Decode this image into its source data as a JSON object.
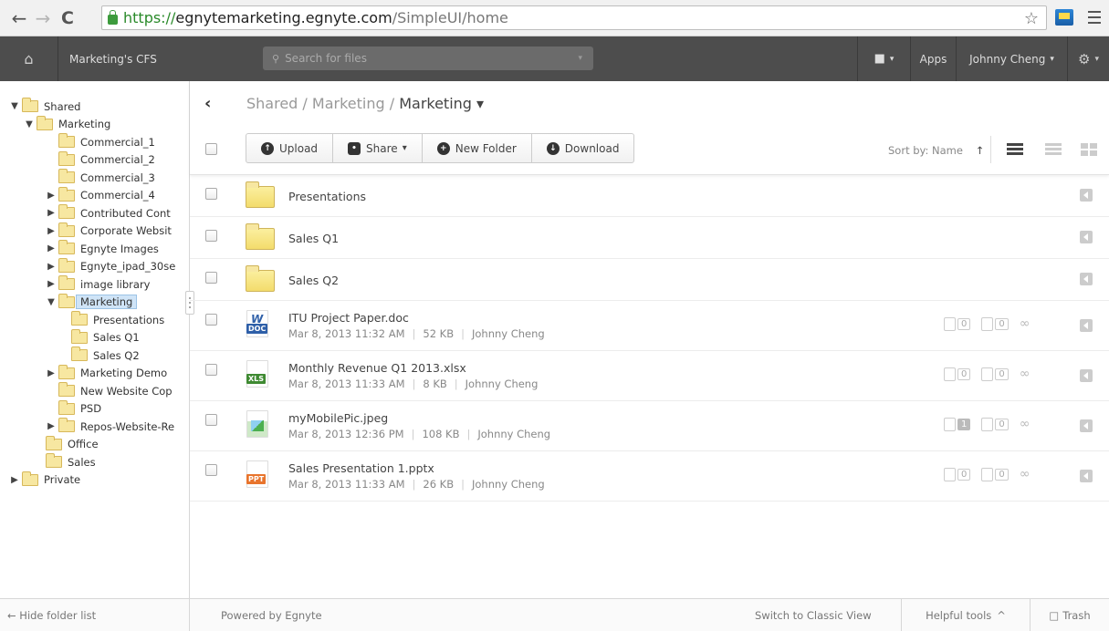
{
  "browser": {
    "back": "←",
    "forward": "→",
    "reload": "C",
    "url_scheme": "https://",
    "url_host": "egnytemarketing.egnyte.com",
    "url_path": "/SimpleUI/home",
    "star": "☆"
  },
  "appbar": {
    "home": "⌂",
    "workspace": "Marketing's CFS",
    "search_placeholder": "Search for files",
    "apps": "Apps",
    "user": "Johnny Cheng",
    "caret": "▾",
    "gear": "⚙",
    "bookmark": "■"
  },
  "tree": [
    {
      "label": "Shared",
      "arrow": "▼"
    },
    {
      "label": "Marketing",
      "arrow": "▼"
    },
    {
      "label": "Commercial_1",
      "arrow": ""
    },
    {
      "label": "Commercial_2",
      "arrow": ""
    },
    {
      "label": "Commercial_3",
      "arrow": ""
    },
    {
      "label": "Commercial_4",
      "arrow": "▶"
    },
    {
      "label": "Contributed Cont",
      "arrow": "▶"
    },
    {
      "label": "Corporate Websit",
      "arrow": "▶"
    },
    {
      "label": "Egnyte Images",
      "arrow": "▶"
    },
    {
      "label": "Egnyte_ipad_30se",
      "arrow": "▶"
    },
    {
      "label": "image library",
      "arrow": "▶"
    },
    {
      "label": "Marketing",
      "arrow": "▼"
    },
    {
      "label": "Presentations",
      "arrow": ""
    },
    {
      "label": "Sales Q1",
      "arrow": ""
    },
    {
      "label": "Sales Q2",
      "arrow": ""
    },
    {
      "label": "Marketing Demo",
      "arrow": "▶"
    },
    {
      "label": "New Website Cop",
      "arrow": ""
    },
    {
      "label": "PSD",
      "arrow": ""
    },
    {
      "label": "Repos-Website-Re",
      "arrow": "▶"
    },
    {
      "label": "Office",
      "arrow": ""
    },
    {
      "label": "Sales",
      "arrow": ""
    },
    {
      "label": "Private",
      "arrow": "▶"
    }
  ],
  "breadcrumb": {
    "back": "‹",
    "part1": "Shared",
    "sep": " / ",
    "part2": "Marketing",
    "current": "Marketing",
    "caret": "▾"
  },
  "toolbar": {
    "upload": "Upload",
    "share": "Share",
    "new_folder": "New Folder",
    "download": "Download",
    "caret": "▾"
  },
  "sort": {
    "label": "Sort by:",
    "value": "Name",
    "arrow": "↑"
  },
  "items": [
    {
      "type": "folder",
      "name": "Presentations"
    },
    {
      "type": "folder",
      "name": "Sales Q1"
    },
    {
      "type": "folder",
      "name": "Sales Q2"
    },
    {
      "type": "file",
      "name": "ITU Project Paper.doc",
      "date": "Mar 8, 2013 11:32 AM",
      "size": "52 KB",
      "owner": "Johnny Cheng",
      "tag": "DOC",
      "tag_color": "#2e5fa8",
      "comments": "0",
      "versions": "0"
    },
    {
      "type": "file",
      "name": "Monthly Revenue Q1 2013.xlsx",
      "date": "Mar 8, 2013 11:33 AM",
      "size": "8 KB",
      "owner": "Johnny Cheng",
      "tag": "XLS",
      "tag_color": "#3f8a32",
      "comments": "0",
      "versions": "0"
    },
    {
      "type": "file",
      "name": "myMobilePic.jpeg",
      "date": "Mar 8, 2013 12:36 PM",
      "size": "108 KB",
      "owner": "Johnny Cheng",
      "tag": "",
      "tag_color": "#4caf50",
      "comments": "1",
      "versions": "0"
    },
    {
      "type": "file",
      "name": "Sales Presentation 1.pptx",
      "date": "Mar 8, 2013 11:33 AM",
      "size": "26 KB",
      "owner": "Johnny Cheng",
      "tag": "PPT",
      "tag_color": "#e8742c",
      "comments": "0",
      "versions": "0"
    }
  ],
  "footer": {
    "hide": "← Hide folder list",
    "powered": "Powered by Egnyte",
    "classic": "Switch to Classic View",
    "tools": "Helpful tools",
    "tools_caret": "^",
    "trash": "Trash"
  }
}
